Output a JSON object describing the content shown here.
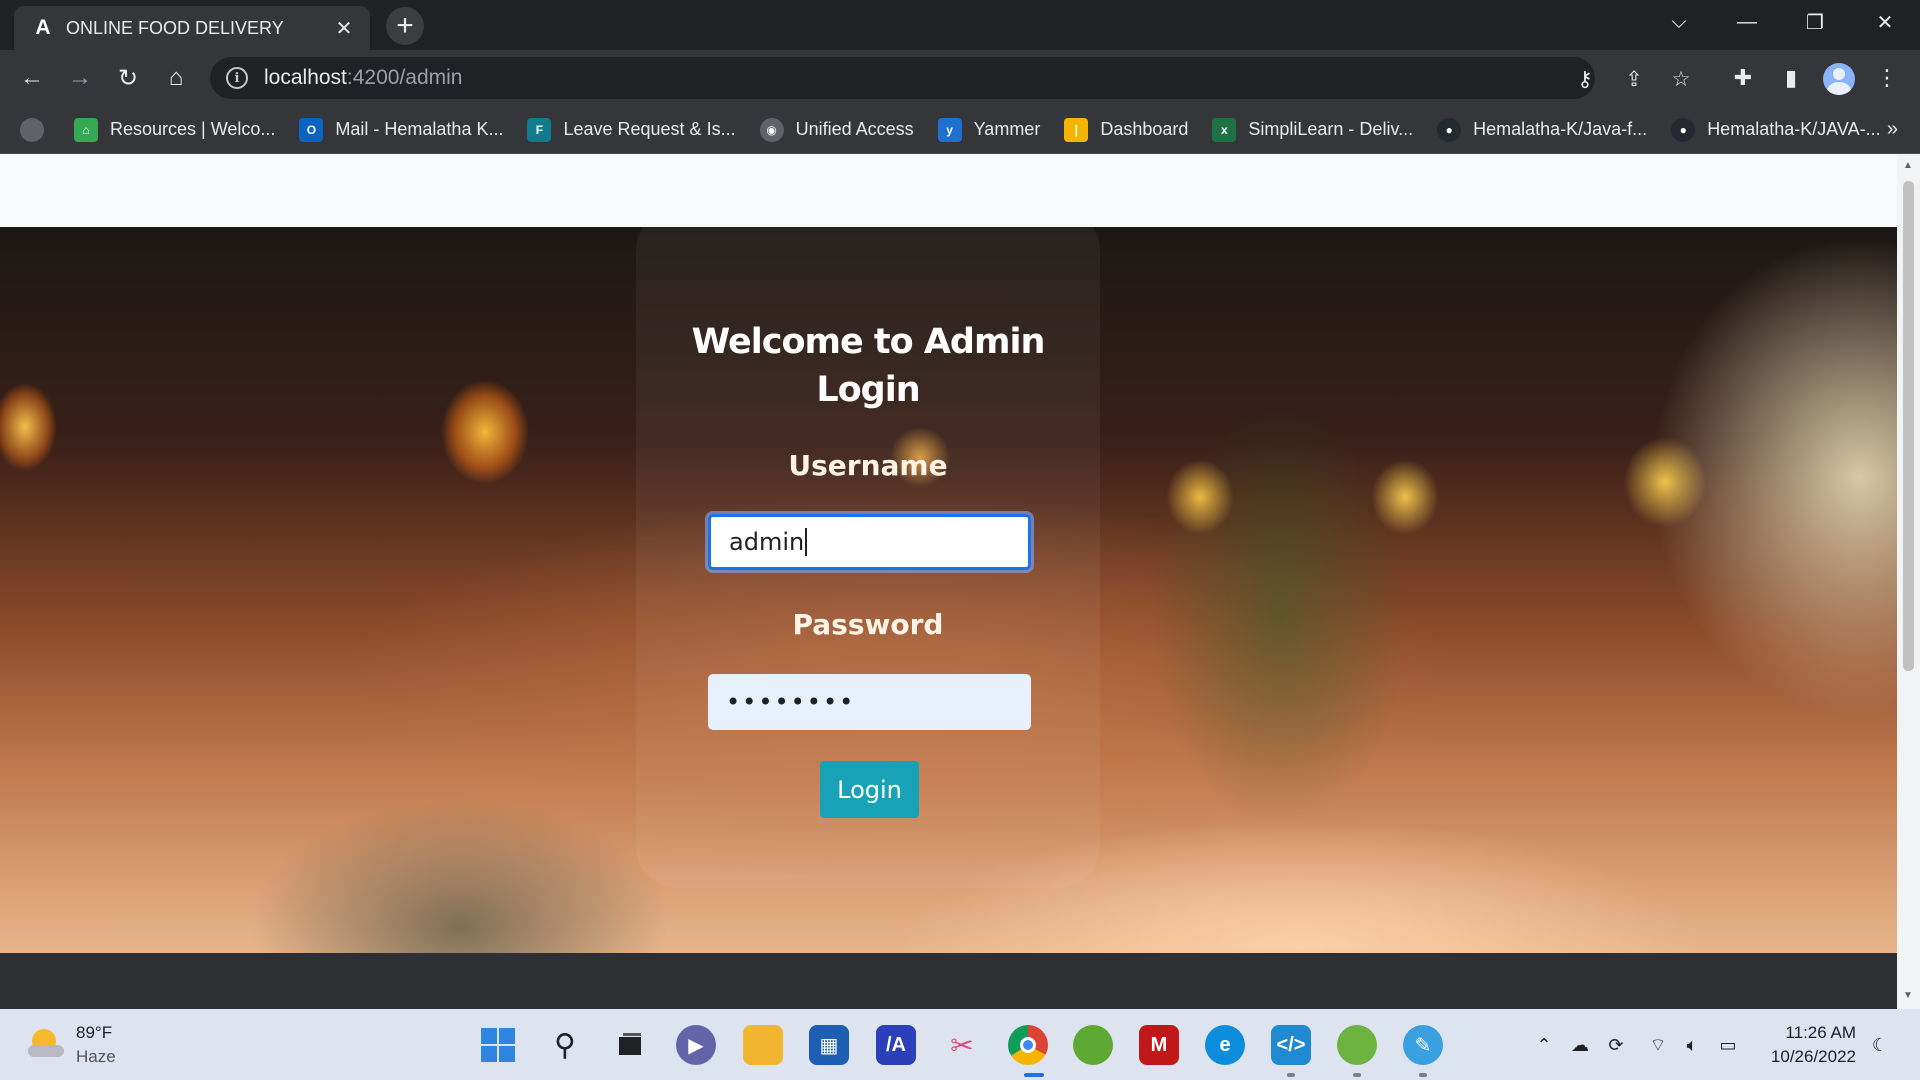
{
  "browser": {
    "tab": {
      "title": "ONLINE FOOD DELIVERY",
      "favicon": "A",
      "close": "✕"
    },
    "new_tab": "+",
    "window_controls": {
      "dropdown": "⌵",
      "minimize": "—",
      "restore": "❐",
      "close": "✕"
    },
    "nav": {
      "back": "←",
      "forward": "→",
      "reload": "↻",
      "home": "⌂"
    },
    "address": {
      "host": "localhost",
      "path": ":4200/admin"
    },
    "bookmarks": [
      {
        "label": "Resources | Welco...",
        "icon": "building-icon",
        "color": "#34a853",
        "glyph": "⌂"
      },
      {
        "label": "Mail - Hemalatha K...",
        "icon": "outlook-icon",
        "color": "#0a64c2",
        "glyph": "O"
      },
      {
        "label": "Leave Request & Is...",
        "icon": "form-icon",
        "color": "#0f7b8c",
        "glyph": "F"
      },
      {
        "label": "Unified Access",
        "icon": "globe-icon",
        "color": "#5f6368",
        "glyph": "◉"
      },
      {
        "label": "Yammer",
        "icon": "yammer-icon",
        "color": "#1f6fd1",
        "glyph": "y"
      },
      {
        "label": "Dashboard",
        "icon": "dashboard-icon",
        "color": "#f4b400",
        "glyph": "|"
      },
      {
        "label": "SimpliLearn - Deliv...",
        "icon": "excel-icon",
        "color": "#1d7145",
        "glyph": "x"
      },
      {
        "label": "Hemalatha-K/Java-f...",
        "icon": "github-icon",
        "color": "#24292f",
        "glyph": "●"
      },
      {
        "label": "Hemalatha-K/JAVA-...",
        "icon": "github-icon",
        "color": "#24292f",
        "glyph": "●"
      }
    ],
    "bookmarks_more": "»"
  },
  "login": {
    "title": "Welcome to Admin Login",
    "username_label": "Username",
    "username_value": "admin",
    "password_label": "Password",
    "password_value": "••••••••",
    "button": "Login",
    "accent_color": "#17a2b8"
  },
  "taskbar": {
    "weather": {
      "temp": "89°F",
      "desc": "Haze"
    },
    "apps": [
      {
        "name": "start-icon",
        "color": "#2f86e0"
      },
      {
        "name": "search-icon",
        "color": "transparent"
      },
      {
        "name": "task-view-icon",
        "color": "transparent"
      },
      {
        "name": "chat-icon",
        "color": "#6264a7"
      },
      {
        "name": "file-explorer-icon",
        "color": "#f2b530"
      },
      {
        "name": "store-icon",
        "color": "#1e5fb4"
      },
      {
        "name": "powerapps-icon",
        "color": "#2b3fb8"
      },
      {
        "name": "snipping-tool-icon",
        "color": "transparent"
      },
      {
        "name": "chrome-icon",
        "color": "#db4437"
      },
      {
        "name": "spring-tool-icon",
        "color": "#5da934"
      },
      {
        "name": "mcafee-icon",
        "color": "#c01818"
      },
      {
        "name": "edge-icon",
        "color": "#0c8ddb"
      },
      {
        "name": "vscode-icon",
        "color": "#1f8ad2"
      },
      {
        "name": "spring-tool-icon",
        "color": "#6db33f"
      },
      {
        "name": "paint-icon",
        "color": "#3aa0e0"
      }
    ],
    "clock": {
      "time": "11:26 AM",
      "date": "10/26/2022"
    }
  }
}
